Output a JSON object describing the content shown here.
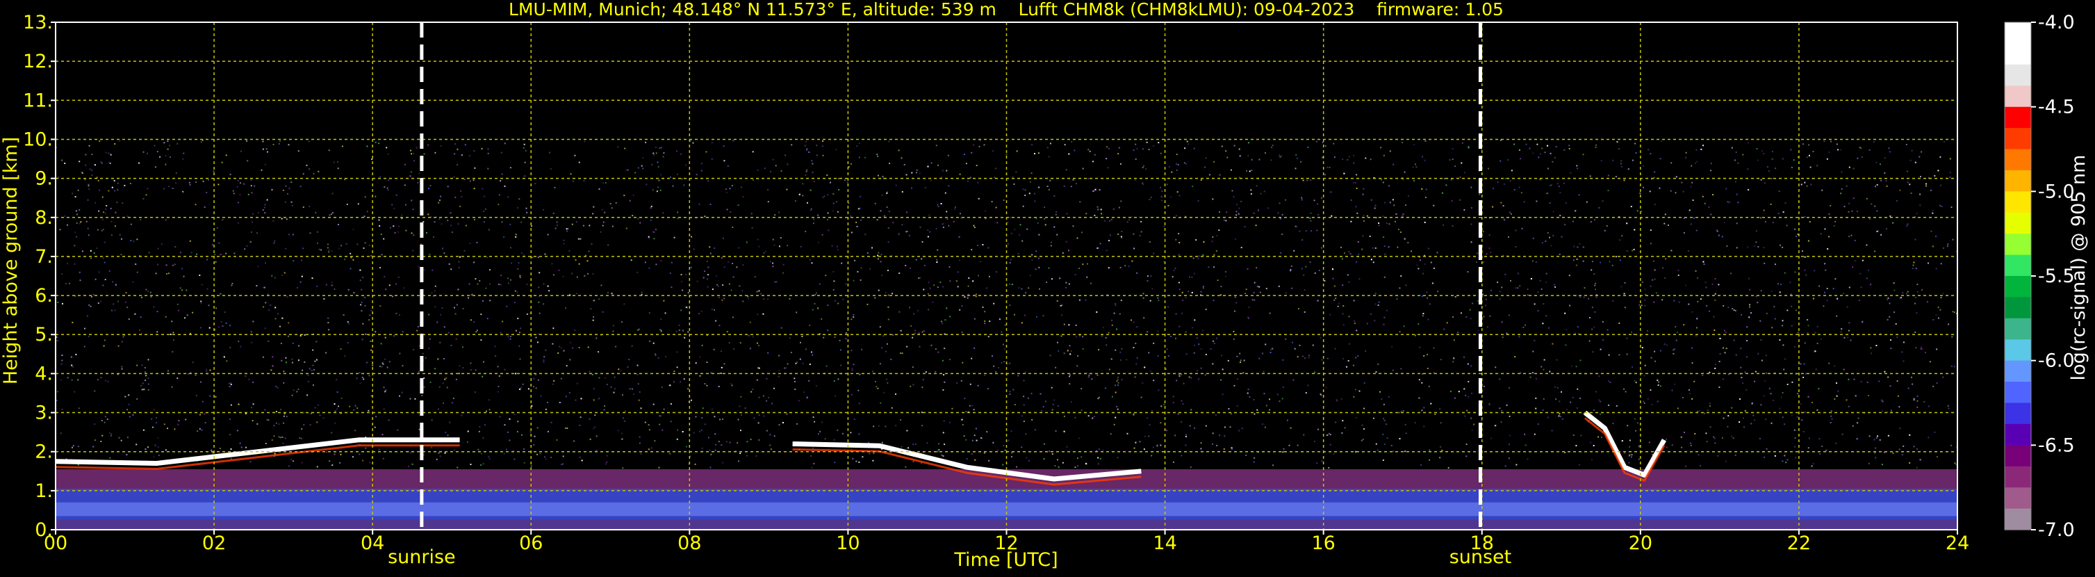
{
  "chart_data": {
    "type": "heatmap",
    "title": "LMU-MIM, Munich; 48.148° N 11.573° E, altitude: 539 m    Lufft CHM8k (CHM8kLMU): 09-04-2023    firmware: 1.05",
    "xlabel": "Time [UTC]",
    "ylabel": "Height above ground [km]",
    "xlim": [
      0,
      24
    ],
    "ylim": [
      0,
      13
    ],
    "x_ticks": [
      "00",
      "02",
      "04",
      "06",
      "08",
      "10",
      "12",
      "14",
      "16",
      "18",
      "20",
      "22",
      "24"
    ],
    "y_ticks": [
      "0.",
      "1.",
      "2.",
      "3.",
      "4.",
      "5.",
      "6.",
      "7.",
      "8.",
      "9.",
      "10.",
      "11.",
      "12.",
      "13."
    ],
    "grid": true,
    "colors": {
      "text": "#ffff00",
      "grid": "#c8c800",
      "background": "#000000",
      "axis": "#ffffff"
    },
    "annotations": [
      {
        "label": "sunrise",
        "time_utc": 4.62
      },
      {
        "label": "sunset",
        "time_utc": 17.98
      }
    ],
    "colorbar": {
      "label": "log(rc-signal) @ 905 nm",
      "range": [
        -7.0,
        -4.0
      ],
      "ticks": [
        "-4.0",
        "-4.5",
        "-5.0",
        "-5.5",
        "-6.0",
        "-6.5",
        "-7.0"
      ],
      "colors": [
        "#ffffff",
        "#ffffff",
        "#e6e6e6",
        "#f0c8c8",
        "#ff0000",
        "#ff3c00",
        "#ff7800",
        "#ffb400",
        "#ffe600",
        "#e6ff00",
        "#96ff32",
        "#32e664",
        "#00b43c",
        "#00963c",
        "#3cb48c",
        "#5ac8e6",
        "#6496ff",
        "#5064ff",
        "#3c32e6",
        "#5a00b4",
        "#780078",
        "#8c2878",
        "#a05a8c",
        "#a08ca0"
      ]
    },
    "noise_top_km": 10,
    "cloud_layers": [
      {
        "t_start": 0.0,
        "t_end": 5.1,
        "base_km": [
          1.75,
          1.7,
          2.0,
          2.3,
          2.3
        ]
      },
      {
        "t_start": 9.3,
        "t_end": 13.7,
        "base_km": [
          2.2,
          2.15,
          1.6,
          1.3,
          1.5
        ]
      },
      {
        "t_start": 19.3,
        "t_end": 20.3,
        "base_km": [
          3.0,
          2.6,
          1.6,
          1.4,
          2.3
        ]
      }
    ]
  }
}
